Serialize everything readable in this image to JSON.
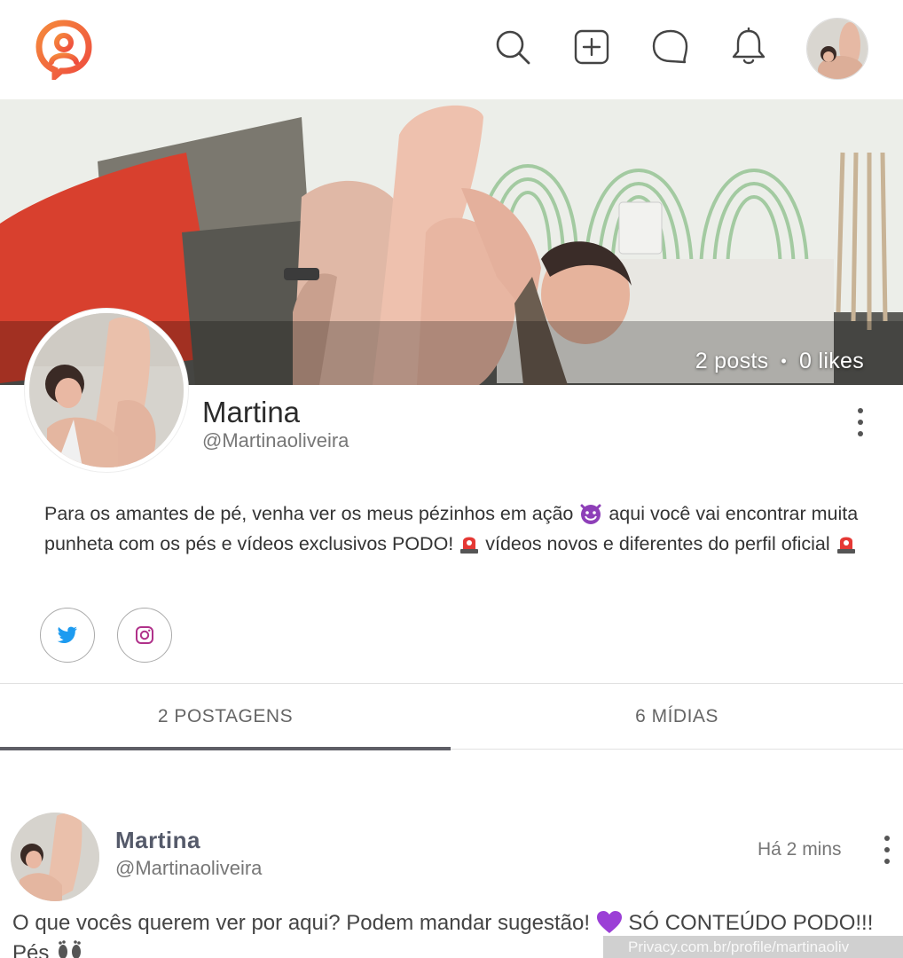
{
  "app": {
    "brand_color": "#f26b3a",
    "logo_icon": "patreon-like-logo-icon"
  },
  "nav": {
    "icons": [
      "search-icon",
      "add-post-icon",
      "chat-icon",
      "bell-icon"
    ]
  },
  "cover": {
    "stats": {
      "posts": "2 posts",
      "separator": "•",
      "likes": "0 likes"
    }
  },
  "profile": {
    "name": "Martina",
    "handle": "@Martinaoliveira",
    "bio": {
      "part1": "Para os amantes de pé, venha ver os meus pézinhos em ação ",
      "part2": " aqui você vai encontrar muita punheta com os pés e vídeos exclusivos PODO! ",
      "part3": " vídeos novos e diferentes do perfil oficial "
    },
    "social": [
      "twitter-icon",
      "instagram-icon"
    ]
  },
  "tabs": {
    "posts": "2 POSTAGENS",
    "media": "6 MÍDIAS",
    "active": "posts"
  },
  "post": {
    "name": "Martina",
    "handle": "@Martinaoliveira",
    "time": "Há 2 mins",
    "text_part1": "O que vocês querem ver por aqui? Podem mandar sugestão! ",
    "text_part2": " SÓ CONTEÚDO PODO!!! Pés "
  },
  "watermark": "Privacy.com.br/profile/martinaoliv"
}
